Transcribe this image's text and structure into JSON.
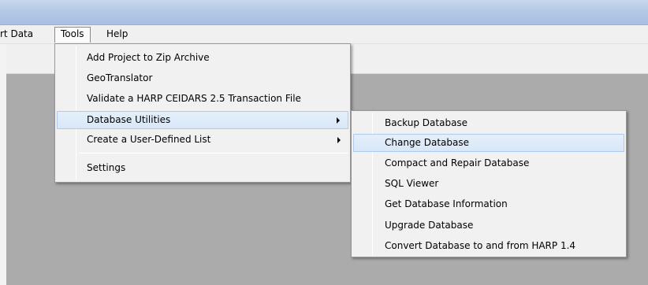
{
  "menubar": {
    "items": [
      "rt Data",
      "Tools",
      "Help"
    ]
  },
  "tools_menu": {
    "items": [
      "Add Project to Zip Archive",
      "GeoTranslator",
      "Validate a HARP CEIDARS 2.5 Transaction File",
      "Database Utilities",
      "Create a User-Defined List",
      "Settings"
    ]
  },
  "db_submenu": {
    "items": [
      "Backup Database",
      "Change Database",
      "Compact and Repair Database",
      "SQL Viewer",
      "Get Database Information",
      "Upgrade Database",
      "Convert Database to and from HARP 1.4"
    ]
  },
  "colors": {
    "client_bg": "#ababab",
    "menu_bg": "#f1f1f1",
    "highlight": "#d8e7f8",
    "highlight_border": "#aecbef"
  }
}
